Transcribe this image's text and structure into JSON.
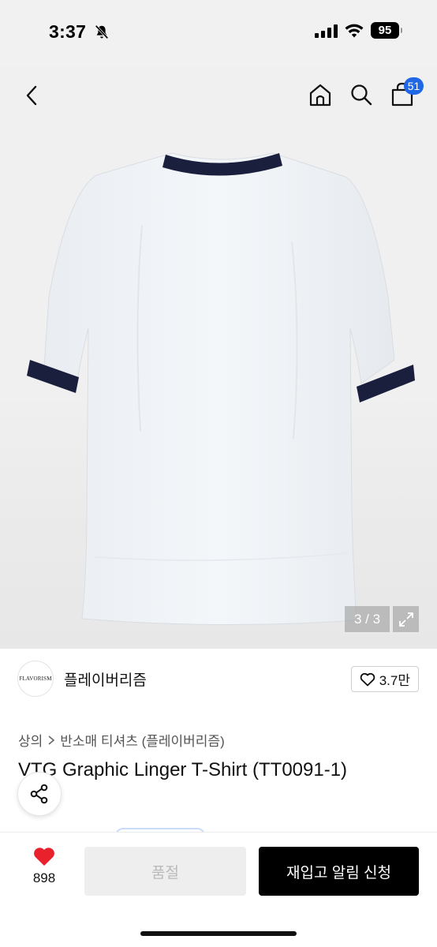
{
  "status_bar": {
    "time": "3:37",
    "battery": "95",
    "icons": [
      "bell-slash-icon",
      "signal-icon",
      "wifi-icon",
      "battery-icon"
    ]
  },
  "nav": {
    "cart_count": "51",
    "icons": [
      "chevron-left-icon",
      "home-icon",
      "search-icon",
      "shopping-bag-icon"
    ]
  },
  "gallery": {
    "counter": "3 / 3",
    "current": 3,
    "total": 3,
    "shirt_color": "#f2f5f8",
    "trim_color": "#1a1f3d"
  },
  "brand": {
    "logo_text": "FLAVORISM",
    "name": "플레이버리즘",
    "likes": "3.7만"
  },
  "breadcrumb": {
    "category": "상의",
    "subcategory": "반소매 티셔츠 (플레이버리즘)"
  },
  "product": {
    "title": "VTG Graphic Linger T-Shirt (TT0091-1)"
  },
  "bottom_bar": {
    "wish_count": "898",
    "soldout_label": "품절",
    "restock_label": "재입고 알림 신청",
    "heart_color": "#e8212d"
  }
}
